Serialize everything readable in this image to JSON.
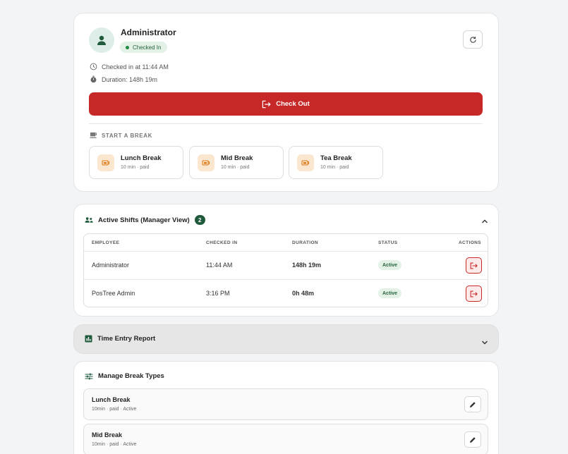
{
  "user": {
    "name": "Administrator",
    "status": "Checked In",
    "checked_in_text": "Checked in at 11:44 AM",
    "duration_text": "Duration: 148h 19m"
  },
  "actions": {
    "checkout_label": "Check Out"
  },
  "breaks": {
    "title": "START A BREAK",
    "items": [
      {
        "name": "Lunch Break",
        "sub": "10 min · paid"
      },
      {
        "name": "Mid Break",
        "sub": "10 min · paid"
      },
      {
        "name": "Tea Break",
        "sub": "10 min · paid"
      }
    ]
  },
  "shifts": {
    "title": "Active Shifts (Manager View)",
    "count": "2",
    "columns": [
      "EMPLOYEE",
      "CHECKED IN",
      "DURATION",
      "STATUS",
      "ACTIONS"
    ],
    "rows": [
      {
        "employee": "Administrator",
        "checked_in": "11:44 AM",
        "duration": "148h 19m",
        "status": "Active"
      },
      {
        "employee": "PosTree Admin",
        "checked_in": "3:16 PM",
        "duration": "0h 48m",
        "status": "Active"
      }
    ]
  },
  "report": {
    "title": "Time Entry Report"
  },
  "break_types": {
    "title": "Manage Break Types",
    "items": [
      {
        "name": "Lunch Break",
        "sub": "10min · paid · Active"
      },
      {
        "name": "Mid Break",
        "sub": "10min · paid · Active"
      }
    ]
  },
  "colors": {
    "accent_red": "#c62828",
    "accent_green": "#1e5a3b",
    "status_green": "#27633d"
  }
}
